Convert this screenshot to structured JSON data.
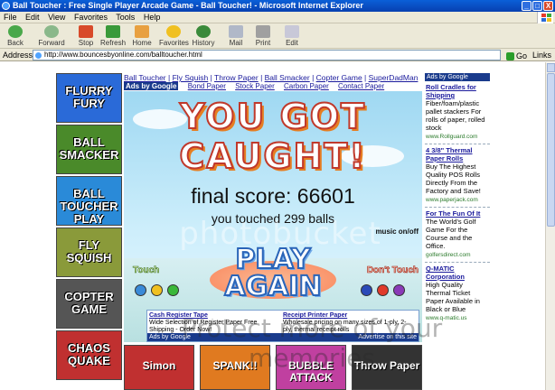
{
  "window": {
    "title": "Ball Toucher : Free Single Player Arcade Game - Ball Toucher! - Microsoft Internet Explorer",
    "min": "_",
    "max": "□",
    "close": "X"
  },
  "menu": [
    "File",
    "Edit",
    "View",
    "Favorites",
    "Tools",
    "Help"
  ],
  "toolbar": {
    "back": "Back",
    "forward": "Forward",
    "stop": "Stop",
    "refresh": "Refresh",
    "home": "Home",
    "favorites": "Favorites",
    "history": "History",
    "mail": "Mail",
    "print": "Print",
    "edit": "Edit"
  },
  "address": {
    "label": "Address",
    "url": "http://www.bouncesbyonline.com/balltoucher.html",
    "go": "Go",
    "links": "Links"
  },
  "left_games": [
    {
      "name": "FLURRY FURY",
      "color": "#2a6ad8"
    },
    {
      "name": "BALL SMACKER",
      "color": "#4a8a2a"
    },
    {
      "name": "BALL TOUCHER PLAY",
      "color": "#2a8ad8"
    },
    {
      "name": "FLY SQUISH",
      "color": "#8a9a3a"
    },
    {
      "name": "COPTER GAME",
      "color": "#555555"
    },
    {
      "name": "CHAOS QUAKE",
      "color": "#c03030"
    }
  ],
  "top_links": [
    "Ball Toucher",
    "Fly Squish",
    "Throw Paper",
    "Ball Smacker",
    "Copter Game",
    "SuperDadMan"
  ],
  "ads_row": {
    "label": "Ads by Google",
    "links": [
      "Bond Paper",
      "Stock Paper",
      "Carbon Paper",
      "Contact Paper"
    ]
  },
  "game": {
    "line1": "YOU GOT",
    "line2": "CAUGHT!",
    "final_score": "final score: 66601",
    "touched": "you touched 299 balls",
    "music": "music on/off",
    "play_again": "PLAY AGAIN",
    "touch_label": "Touch",
    "dont_touch_label": "Don't Touch"
  },
  "inner_ads": {
    "ad1_title": "Cash Register Tape",
    "ad1_text": "Wide Selection of Register Paper Free Shipping - Order Now!",
    "ad2_title": "Receipt Printer Paper",
    "ad2_text": "Wholesale pricing on many sizes of 1-ply, 2-ply, thermal receipt rolls",
    "footer_left": "Ads by Google",
    "footer_right": "Advertise on this site"
  },
  "bottom_games": [
    {
      "name": "Simon",
      "color": "#c03030"
    },
    {
      "name": "SPANK!!",
      "color": "#e07a20"
    },
    {
      "name": "BUBBLE ATTACK",
      "color": "#c040a0"
    },
    {
      "name": "Throw Paper",
      "color": "#333333"
    }
  ],
  "right_ads": {
    "header": "Ads by Google",
    "ads": [
      {
        "title": "Roll Cradles for Shipping",
        "text": "Fiber/foam/plastic pallet stackers For rolls of paper, rolled stock",
        "url": "www.Rollguard.com"
      },
      {
        "title": "4 3/8\" Thermal Paper Rolls",
        "text": "Buy The Highest Quality POS Rolls Directly From the Factory and Save!",
        "url": "www.paperjack.com"
      },
      {
        "title": "For The Fun Of It",
        "text": "The World's Golf Game For the Course and the Office.",
        "url": "golfersdirect.com"
      },
      {
        "title": "Q-MATIC Corporation",
        "text": "High Quality Thermal Ticket Paper Available in Black or Blue",
        "url": "www.q-matic.us"
      }
    ]
  },
  "watermark": {
    "main": "photobucket",
    "sub": "Protect more of your memories"
  }
}
